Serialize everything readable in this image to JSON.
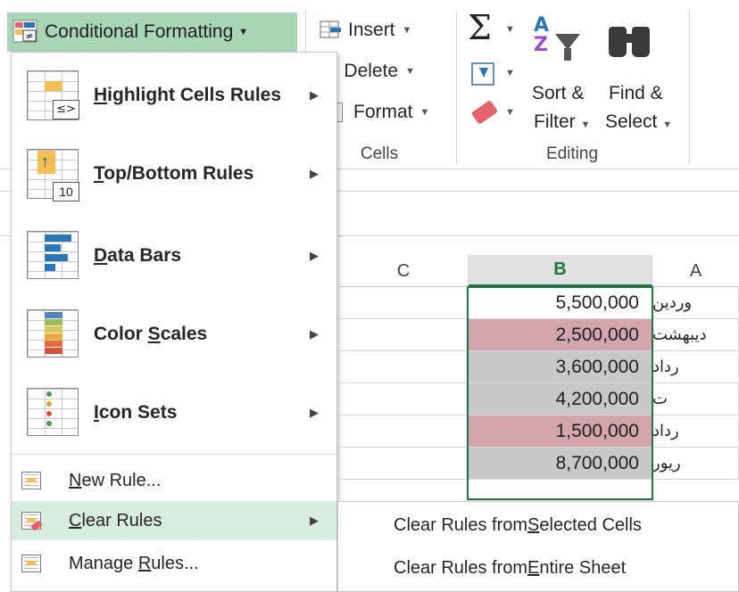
{
  "ribbon": {
    "conditional_formatting_label": "Conditional Formatting",
    "cells_group": {
      "insert_label": "Insert",
      "delete_label": "Delete",
      "format_label": "Format",
      "group_label": "Cells"
    },
    "editing_group": {
      "sort_filter_line1": "Sort &",
      "sort_filter_line2": "Filter",
      "find_select_line1": "Find &",
      "find_select_line2": "Select",
      "group_label": "Editing"
    }
  },
  "sheet": {
    "columns": [
      {
        "label": "C",
        "active": false
      },
      {
        "label": "B",
        "active": true
      },
      {
        "label": "A",
        "active": false
      }
    ],
    "rows": [
      {
        "b": "5,500,000",
        "a": "وردین",
        "fill": "#ffffff"
      },
      {
        "b": "2,500,000",
        "a": "دیبهشت",
        "fill": "#d2a6ab"
      },
      {
        "b": "3,600,000",
        "a": "رداد",
        "fill": "#c8c8c8"
      },
      {
        "b": "4,200,000",
        "a": "ت",
        "fill": "#c8c8c8"
      },
      {
        "b": "1,500,000",
        "a": "رداد",
        "fill": "#d2a6ab"
      },
      {
        "b": "8,700,000",
        "a": "ریور",
        "fill": "#c8c8c8"
      }
    ]
  },
  "menu": {
    "highlight_cells_rules": {
      "underline": "H",
      "rest": "ighlight Cells Rules"
    },
    "highlight_box_text": "≤>",
    "top_bottom_rules": {
      "underline": "T",
      "rest": "op/Bottom Rules"
    },
    "top_bottom_box_text": "10",
    "data_bars": {
      "underline": "D",
      "rest": "ata Bars"
    },
    "color_scales": {
      "before": "Color ",
      "underline": "S",
      "rest": "cales"
    },
    "icon_sets": {
      "underline": "I",
      "rest": "con Sets"
    },
    "new_rule": {
      "underline": "N",
      "rest": "ew Rule..."
    },
    "clear_rules": {
      "underline": "C",
      "rest": "lear Rules"
    },
    "manage_rules": {
      "before": "Manage ",
      "underline": "R",
      "rest": "ules..."
    },
    "submenu_arrow": "▶"
  },
  "submenu": {
    "selected_cells": {
      "before": "Clear Rules from ",
      "underline": "S",
      "rest": "elected Cells"
    },
    "entire_sheet": {
      "before": "Clear Rules from ",
      "underline": "E",
      "rest": "ntire Sheet"
    }
  },
  "colors": {
    "accent": "#217346",
    "menu_hover": "#d8ecdf",
    "button_active": "#a8d6b7",
    "highlight_pink": "#d2a6ab",
    "highlight_gray": "#c8c8c8"
  },
  "icons": [
    "conditional-formatting-icon",
    "insert-cells-icon",
    "delete-cells-icon",
    "format-cells-icon",
    "autosum-icon",
    "fill-icon",
    "clear-icon",
    "sort-filter-icon",
    "find-select-icon"
  ]
}
